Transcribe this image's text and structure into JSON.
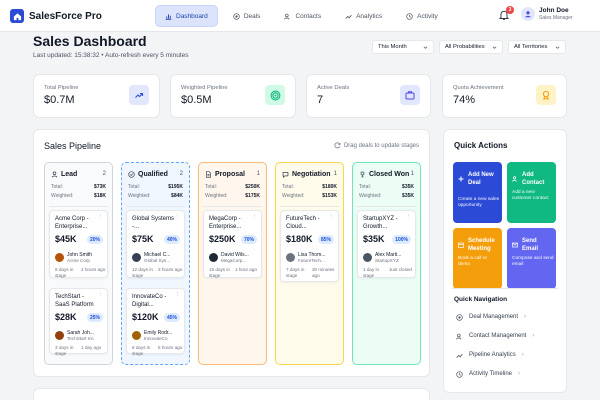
{
  "app": {
    "name": "SalesForce Pro"
  },
  "nav": {
    "tabs": [
      {
        "label": "Dashboard",
        "icon": "chart-icon"
      },
      {
        "label": "Deals",
        "icon": "target-icon"
      },
      {
        "label": "Contacts",
        "icon": "users-icon"
      },
      {
        "label": "Analytics",
        "icon": "trend-icon"
      },
      {
        "label": "Activity",
        "icon": "clock-icon"
      }
    ],
    "notification_count": "3",
    "user": {
      "name": "John Doe",
      "role": "Sales Manager"
    }
  },
  "header": {
    "title": "Sales Dashboard",
    "last_updated": "Last updated: 15:38:32 • Auto-refresh every 5 minutes",
    "filters": [
      "This Month",
      "All Probabilities",
      "All Territories"
    ]
  },
  "stats": [
    {
      "label": "Total Pipeline",
      "value": "$0.7M",
      "icon": "trend-up-icon",
      "color": "#2b4bd6"
    },
    {
      "label": "Weighted Pipeline",
      "value": "$0.5M",
      "icon": "target-icon",
      "color": "#10b981"
    },
    {
      "label": "Active Deals",
      "value": "7",
      "icon": "briefcase-icon",
      "color": "#4f46e5"
    },
    {
      "label": "Quota Achievement",
      "value": "74%",
      "icon": "award-icon",
      "color": "#f59e0b"
    }
  ],
  "pipeline": {
    "title": "Sales Pipeline",
    "hint": "Drag deals to update stages",
    "total_label": "Total:",
    "weighted_label": "Weighted:",
    "columns": [
      {
        "name": "Lead",
        "count": "2",
        "total": "$73K",
        "weighted": "$18K",
        "deals": [
          {
            "name": "Acme Corp - Enterprise...",
            "amount": "$45K",
            "prob": "20%",
            "contact": "John Smith",
            "company": "Acme Corp",
            "stage": "5 days in stage",
            "activity": "2 hours ago"
          },
          {
            "name": "TechStart - SaaS Platform",
            "amount": "$28K",
            "prob": "25%",
            "contact": "Sarah Joh...",
            "company": "TechStart Inc",
            "stage": "3 days in stage",
            "activity": "1 day ago"
          }
        ]
      },
      {
        "name": "Qualified",
        "count": "2",
        "total": "$195K",
        "weighted": "$84K",
        "deals": [
          {
            "name": "Global Systems -...",
            "amount": "$75K",
            "prob": "40%",
            "contact": "Michael C...",
            "company": "Global Sys...",
            "stage": "12 days in stage",
            "activity": "3 hours ago"
          },
          {
            "name": "InnovateCo - Digital...",
            "amount": "$120K",
            "prob": "45%",
            "contact": "Emily Rodr...",
            "company": "InnovateCo",
            "stage": "8 days in stage",
            "activity": "5 hours ago"
          }
        ]
      },
      {
        "name": "Proposal",
        "count": "1",
        "total": "$250K",
        "weighted": "$175K",
        "deals": [
          {
            "name": "MegaCorp - Enterprise...",
            "amount": "$250K",
            "prob": "70%",
            "contact": "David Wils...",
            "company": "MegaCorp...",
            "stage": "15 days in stage",
            "activity": "1 hour ago"
          }
        ]
      },
      {
        "name": "Negotiation",
        "count": "1",
        "total": "$180K",
        "weighted": "$153K",
        "deals": [
          {
            "name": "FutureTech - Cloud...",
            "amount": "$180K",
            "prob": "85%",
            "contact": "Lisa Thom...",
            "company": "FutureTech...",
            "stage": "7 days in stage",
            "activity": "30 minutes ago"
          }
        ]
      },
      {
        "name": "Closed Won",
        "count": "1",
        "total": "$35K",
        "weighted": "$35K",
        "deals": [
          {
            "name": "StartupXYZ - Growth...",
            "amount": "$35K",
            "prob": "100%",
            "contact": "Alex Marti...",
            "company": "StartupXYZ",
            "stage": "1 day in stage",
            "activity": "Just closed"
          }
        ]
      }
    ]
  },
  "quick_actions": {
    "title": "Quick Actions",
    "tiles": [
      {
        "title": "Add New Deal",
        "desc": "Create a new sales opportunity",
        "color": "#2b4bd6",
        "icon": "plus-icon"
      },
      {
        "title": "Add Contact",
        "desc": "Add a new customer contact",
        "color": "#10b981",
        "icon": "user-plus-icon"
      },
      {
        "title": "Schedule Meeting",
        "desc": "Book a call or demo",
        "color": "#f59e0b",
        "icon": "calendar-icon"
      },
      {
        "title": "Send Email",
        "desc": "Compose and send email",
        "color": "#6366f1",
        "icon": "mail-icon"
      }
    ],
    "nav_title": "Quick Navigation",
    "nav_items": [
      {
        "label": "Deal Management",
        "icon": "target-icon"
      },
      {
        "label": "Contact Management",
        "icon": "users-icon"
      },
      {
        "label": "Pipeline Analytics",
        "icon": "trend-icon"
      },
      {
        "label": "Activity Timeline",
        "icon": "clock-icon"
      }
    ]
  }
}
